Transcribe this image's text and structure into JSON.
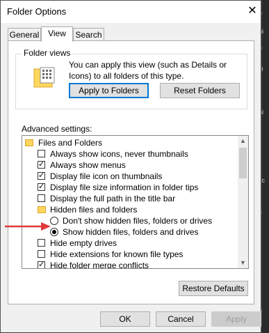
{
  "window": {
    "title": "Folder Options"
  },
  "tabs": [
    "General",
    "View",
    "Search"
  ],
  "folder_views": {
    "label": "Folder views",
    "description": "You can apply this view (such as Details or Icons) to all folders of this type.",
    "apply_button": "Apply to Folders",
    "reset_button": "Reset Folders"
  },
  "advanced": {
    "label": "Advanced settings:",
    "items": [
      {
        "type": "folder",
        "label": "Files and Folders"
      },
      {
        "type": "checkbox",
        "label": "Always show icons, never thumbnails",
        "checked": false
      },
      {
        "type": "checkbox",
        "label": "Always show menus",
        "checked": true
      },
      {
        "type": "checkbox",
        "label": "Display file icon on thumbnails",
        "checked": true
      },
      {
        "type": "checkbox",
        "label": "Display file size information in folder tips",
        "checked": true
      },
      {
        "type": "checkbox",
        "label": "Display the full path in the title bar",
        "checked": false
      },
      {
        "type": "folder",
        "label": "Hidden files and folders"
      },
      {
        "type": "radio",
        "label": "Don't show hidden files, folders or drives",
        "checked": false
      },
      {
        "type": "radio",
        "label": "Show hidden files, folders and drives",
        "checked": true
      },
      {
        "type": "checkbox",
        "label": "Hide empty drives",
        "checked": false
      },
      {
        "type": "checkbox",
        "label": "Hide extensions for known file types",
        "checked": false
      },
      {
        "type": "checkbox",
        "label": "Hide folder merge conflicts",
        "checked": true
      }
    ]
  },
  "buttons": {
    "restore_defaults": "Restore Defaults",
    "ok": "OK",
    "cancel": "Cancel",
    "apply": "Apply"
  },
  "background_strip": [
    "e",
    "ni",
    "e",
    "vi",
    "ni",
    "l",
    "yc",
    "e",
    "n"
  ],
  "colors": {
    "accent": "#0078d7",
    "arrow": "#e0393b"
  },
  "icons": {
    "close": "close-icon",
    "folder": "folder-icon",
    "folder_views": "folder-views-icon",
    "scroll_up": "scroll-up-icon",
    "scroll_down": "scroll-down-icon"
  }
}
